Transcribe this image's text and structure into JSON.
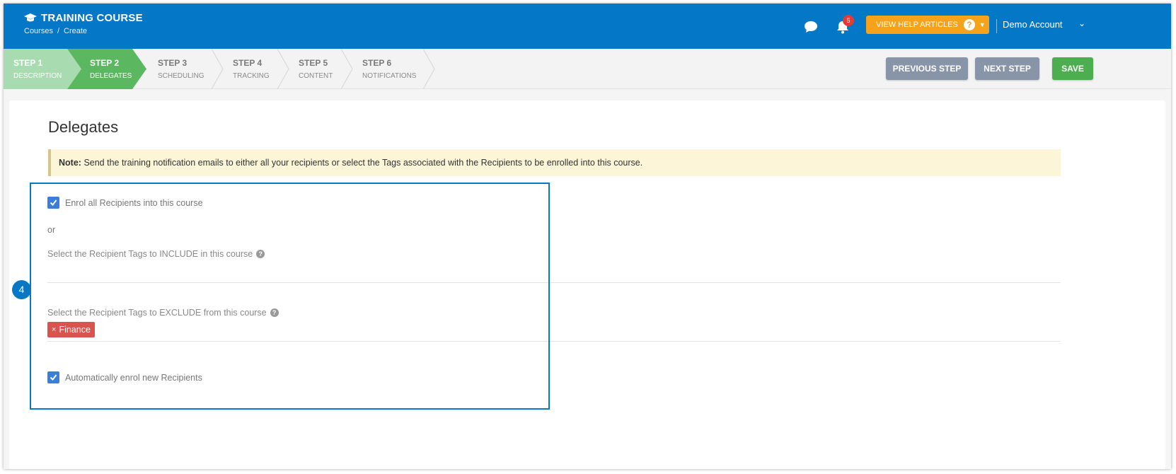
{
  "header": {
    "title": "TRAINING COURSE",
    "breadcrumb": [
      "Courses",
      "/",
      "Create"
    ],
    "notification_count": "5",
    "help_label": "VIEW HELP ARTICLES",
    "account_label": "Demo Account",
    "colors": {
      "header_bg": "#0478c7",
      "help_bg": "#f7a21b",
      "badge": "#e53935"
    }
  },
  "steps": [
    {
      "num": "STEP 1",
      "label": "DESCRIPTION",
      "state": "complete"
    },
    {
      "num": "STEP 2",
      "label": "DELEGATES",
      "state": "active"
    },
    {
      "num": "STEP 3",
      "label": "SCHEDULING",
      "state": "pending"
    },
    {
      "num": "STEP 4",
      "label": "TRACKING",
      "state": "pending"
    },
    {
      "num": "STEP 5",
      "label": "CONTENT",
      "state": "pending"
    },
    {
      "num": "STEP 6",
      "label": "NOTIFICATIONS",
      "state": "pending"
    }
  ],
  "actions": {
    "previous": "PREVIOUS STEP",
    "next": "NEXT STEP",
    "save": "SAVE"
  },
  "main": {
    "title": "Delegates",
    "note_bold": "Note:",
    "note_text": "Send the training notification emails to either all your recipients or select the Tags associated with the Recipients to be enrolled into this course.",
    "enrol_all_label": "Enrol all Recipients into this course",
    "enrol_all_checked": true,
    "or_text": "or",
    "include_label": "Select the Recipient Tags to INCLUDE in this course",
    "include_tags": [],
    "exclude_label": "Select the Recipient Tags to EXCLUDE from this course",
    "exclude_tags": [
      "Finance"
    ],
    "auto_enrol_label": "Automatically enrol new Recipients",
    "auto_enrol_checked": true
  },
  "annotation": {
    "marker": "4"
  }
}
